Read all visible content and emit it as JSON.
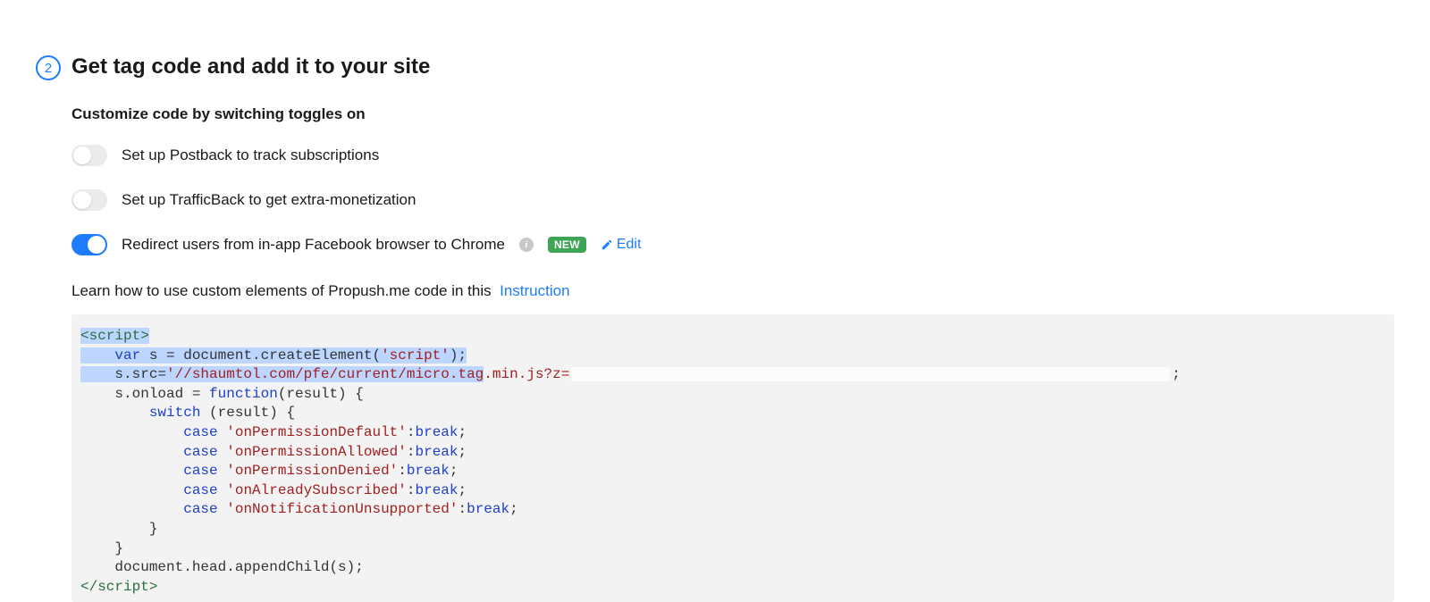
{
  "step": {
    "number": "2",
    "title": "Get tag code and add it to your site"
  },
  "subheading": "Customize code by switching toggles on",
  "toggles": [
    {
      "label": "Set up Postback to track subscriptions"
    },
    {
      "label": "Set up TrafficBack to get extra-monetization"
    },
    {
      "label": "Redirect users from in-app Facebook browser to Chrome"
    }
  ],
  "badge_new": "NEW",
  "edit_label": "Edit",
  "learn_text": "Learn how to use custom elements of Propush.me code in this",
  "learn_link": "Instruction",
  "code": {
    "tag_open": "<script>",
    "tag_close": "</script>",
    "var_kw": "var",
    "var_rest": " s = document.createElement(",
    "var_str": "'script'",
    "var_end": ");",
    "src_pre": "    s.src=",
    "src_str1": "'//shaumtol.com/pfe/current/micro.tag",
    "src_str2": ".min.js?z=",
    "src_end": ";",
    "onload": "    s.onload = ",
    "func_kw": "function",
    "func_args": "(result) {",
    "switch_pre": "        ",
    "switch_kw": "switch",
    "switch_args": " (result) {",
    "case_pre": "            ",
    "case_kw": "case",
    "break_kw": "break",
    "case1": "'onPermissionDefault'",
    "case2": "'onPermissionAllowed'",
    "case3": "'onPermissionDenied'",
    "case4": "'onAlreadySubscribed'",
    "case5": "'onNotificationUnsupported'",
    "brace1": "        }",
    "brace2": "    }",
    "append": "    document.head.appendChild(s);"
  }
}
